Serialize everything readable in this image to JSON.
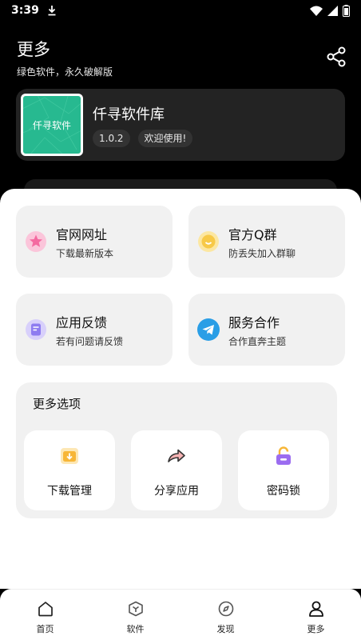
{
  "status_bar": {
    "time": "3:39"
  },
  "header": {
    "title": "更多",
    "subtitle": "绿色软件，永久破解版"
  },
  "app_card": {
    "logo_text": "仟寻软件",
    "name": "仟寻软件库",
    "version": "1.0.2",
    "welcome": "欢迎使用!"
  },
  "tiles": [
    {
      "title": "官网网址",
      "desc": "下载最新版本",
      "icon": "star-icon",
      "color": "#f46aa0"
    },
    {
      "title": "官方Q群",
      "desc": "防丢失加入群聊",
      "icon": "smile-icon",
      "color": "#f7c948"
    },
    {
      "title": "应用反馈",
      "desc": "若有问题请反馈",
      "icon": "feedback-icon",
      "color": "#8e7cf0"
    },
    {
      "title": "服务合作",
      "desc": "合作直奔主题",
      "icon": "telegram-icon",
      "color": "#2a9ee6"
    }
  ],
  "more_options": {
    "title": "更多选项",
    "items": [
      {
        "label": "下载管理",
        "icon": "download-folder-icon",
        "color": "#f7b637"
      },
      {
        "label": "分享应用",
        "icon": "share-arrow-icon",
        "color": "#f08a8a"
      },
      {
        "label": "密码锁",
        "icon": "unlock-icon",
        "color": "#9b6cf0"
      }
    ]
  },
  "bottom_nav": [
    {
      "label": "首页",
      "icon": "home-icon"
    },
    {
      "label": "软件",
      "icon": "cube-icon"
    },
    {
      "label": "发现",
      "icon": "compass-icon"
    },
    {
      "label": "更多",
      "icon": "user-icon"
    }
  ]
}
